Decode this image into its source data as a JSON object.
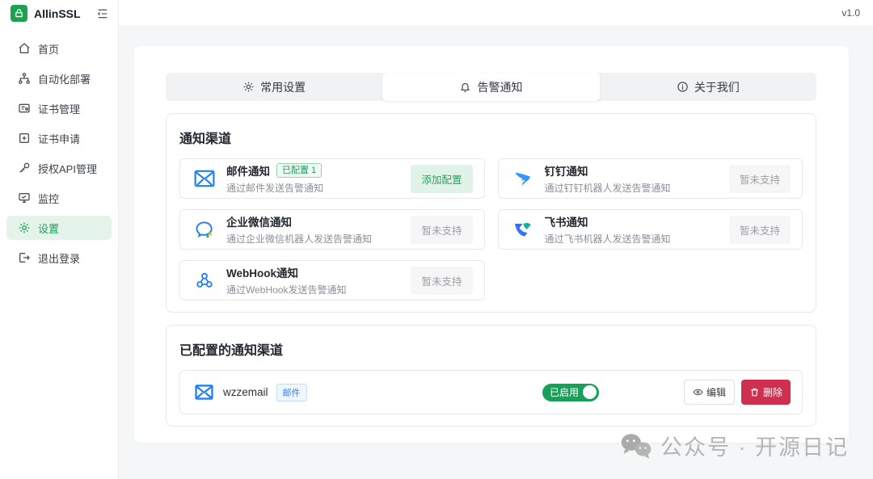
{
  "app": {
    "name": "AllinSSL",
    "version": "v1.0"
  },
  "sidebar": {
    "items": [
      {
        "label": "首页"
      },
      {
        "label": "自动化部署"
      },
      {
        "label": "证书管理"
      },
      {
        "label": "证书申请"
      },
      {
        "label": "授权API管理"
      },
      {
        "label": "监控"
      },
      {
        "label": "设置",
        "active": true
      },
      {
        "label": "退出登录"
      }
    ]
  },
  "tabs": [
    {
      "label": "常用设置"
    },
    {
      "label": "告警通知",
      "active": true
    },
    {
      "label": "关于我们"
    }
  ],
  "channels": {
    "section_title": "通知渠道",
    "items": [
      {
        "name": "邮件通知",
        "badge": "已配置 1",
        "desc": "通过邮件发送告警通知",
        "action": "添加配置",
        "icon": "email-icon"
      },
      {
        "name": "钉钉通知",
        "desc": "通过钉钉机器人发送告警通知",
        "action": "暂未支持",
        "icon": "dingtalk-icon"
      },
      {
        "name": "企业微信通知",
        "desc": "通过企业微信机器人发送告警通知",
        "action": "暂未支持",
        "icon": "wecom-icon"
      },
      {
        "name": "飞书通知",
        "desc": "通过飞书机器人发送告警通知",
        "action": "暂未支持",
        "icon": "feishu-icon"
      },
      {
        "name": "WebHook通知",
        "desc": "通过WebHook发送告警通知",
        "action": "暂未支持",
        "icon": "webhook-icon"
      }
    ]
  },
  "configured": {
    "section_title": "已配置的通知渠道",
    "items": [
      {
        "name": "wzzemail",
        "type_badge": "邮件",
        "toggle_label": "已启用",
        "enabled": true,
        "edit_label": "编辑",
        "delete_label": "删除"
      }
    ]
  },
  "watermark": {
    "text": "公众号 · 开源日记"
  },
  "colors": {
    "primary_green": "#18a058",
    "accent_blue": "#2080f0",
    "danger_red": "#d03050"
  }
}
